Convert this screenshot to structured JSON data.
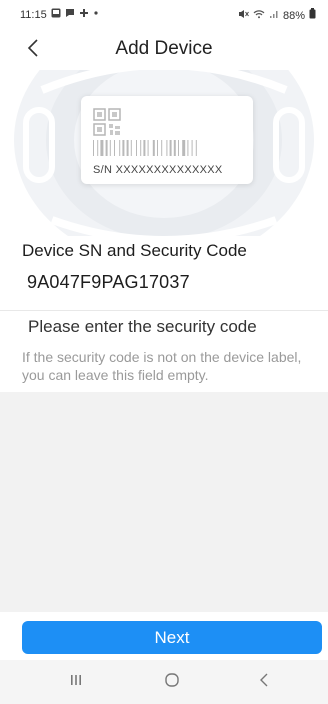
{
  "status_bar": {
    "time": "11:15",
    "battery": "88%",
    "left_icons": [
      "gallery-icon",
      "chat-icon",
      "network-icon",
      "dot-icon"
    ],
    "right_icons": [
      "mute-icon",
      "wifi-icon",
      "signal-icon",
      "battery-icon"
    ]
  },
  "header": {
    "title": "Add Device",
    "back_icon": "chevron-left-icon"
  },
  "device_label": {
    "sn_text": "S/N  XXXXXXXXXXXXXX"
  },
  "form": {
    "section_label": "Device SN and Security Code",
    "sn_value": "9A047F9PAG17037",
    "security_code_placeholder": "Please enter the security code",
    "security_code_value": "",
    "hint": "If the security code is not on the device label, you can leave this field empty."
  },
  "actions": {
    "next_label": "Next"
  },
  "nav_bar": {
    "buttons": [
      "recent-apps-icon",
      "home-icon",
      "back-icon"
    ]
  },
  "colors": {
    "accent": "#1d8ff5",
    "hint_text": "#9a9a9a",
    "background": "#f2f2f2"
  }
}
